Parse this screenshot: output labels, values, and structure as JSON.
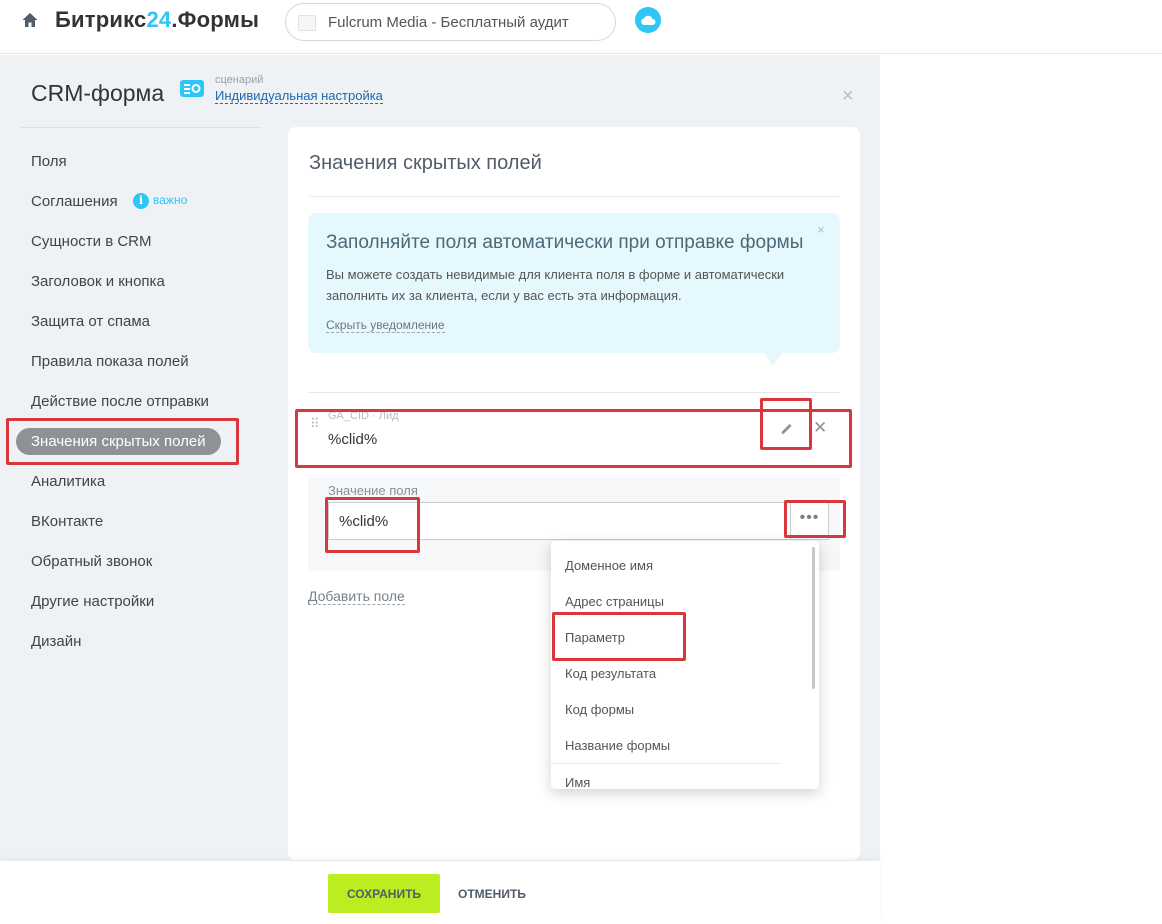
{
  "header": {
    "brand_main": "Битрикс",
    "brand_num": "24",
    "brand_suffix": ".Формы",
    "site_title": "Fulcrum Media - Бесплатный аудит",
    "icons": {
      "home": "home-icon",
      "cloud": "cloud-icon",
      "site": "site-thumb-icon"
    }
  },
  "panel": {
    "title": "CRM-форма",
    "scenario_caption": "сценарий",
    "scenario_link": "Индивидуальная настройка",
    "close_symbol": "×"
  },
  "sidebar": {
    "items": [
      {
        "label": "Поля"
      },
      {
        "label": "Соглашения"
      },
      {
        "label": "Сущности в CRM"
      },
      {
        "label": "Заголовок и кнопка"
      },
      {
        "label": "Защита от спама"
      },
      {
        "label": "Правила показа полей"
      },
      {
        "label": "Действие после отправки"
      },
      {
        "label": "Значения скрытых полей",
        "active": true
      },
      {
        "label": "Аналитика"
      },
      {
        "label": "ВКонтакте"
      },
      {
        "label": "Обратный звонок"
      },
      {
        "label": "Другие настройки"
      },
      {
        "label": "Дизайн"
      }
    ],
    "important_badge": "i",
    "important_label": "важно"
  },
  "content": {
    "title": "Значения скрытых полей",
    "notice": {
      "title": "Заполняйте поля автоматически при отправке формы",
      "text": "Вы можете создать невидимые для клиента поля в форме и автоматически заполнить их за клиента, если у вас есть эта информация.",
      "hide_link": "Скрыть уведомление",
      "close_symbol": "×"
    },
    "field": {
      "caption": "GA_CID · Лид",
      "value": "%clid%",
      "drag_symbol": "⠿",
      "delete_symbol": "✕"
    },
    "value_block": {
      "label": "Значение поля",
      "input_value": "%clid%",
      "more_button": "•••"
    },
    "add_field": "Добавить поле",
    "dropdown": {
      "items": [
        "Доменное имя",
        "Адрес страницы",
        "Параметр",
        "Код результата",
        "Код формы",
        "Название формы",
        "Имя"
      ]
    }
  },
  "footer": {
    "save": "СОХРАНИТЬ",
    "cancel": "ОТМЕНИТЬ"
  },
  "colors": {
    "accent": "#2fc6f6",
    "save_button": "#bbed21",
    "highlight": "#d9373d",
    "active_nav": "#8e9296"
  }
}
